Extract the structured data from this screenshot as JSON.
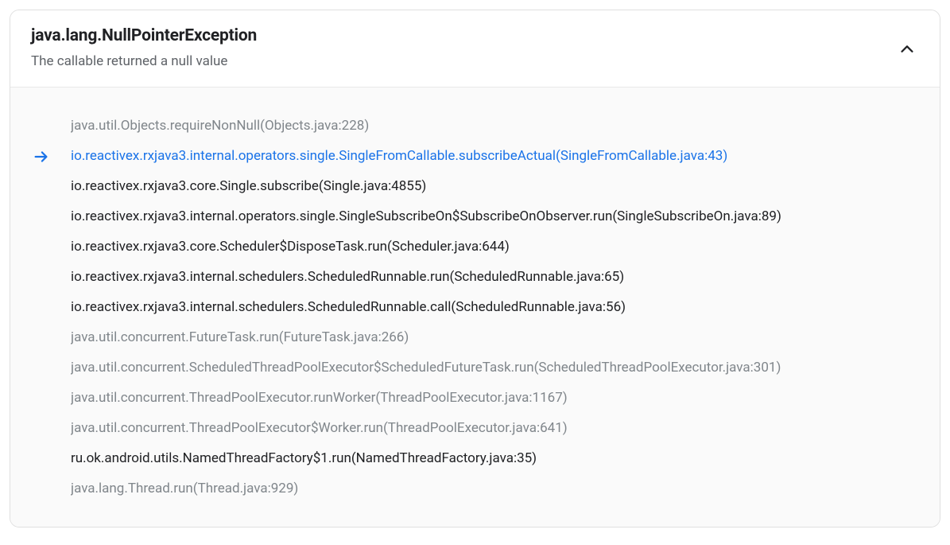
{
  "exception": {
    "title": "java.lang.NullPointerException",
    "message": "The callable returned a null value"
  },
  "stack_frames": [
    {
      "text": "java.util.Objects.requireNonNull(Objects.java:228)",
      "style": "system",
      "highlighted": false
    },
    {
      "text": "io.reactivex.rxjava3.internal.operators.single.SingleFromCallable.subscribeActual(SingleFromCallable.java:43)",
      "style": "app",
      "highlighted": true
    },
    {
      "text": "io.reactivex.rxjava3.core.Single.subscribe(Single.java:4855)",
      "style": "app",
      "highlighted": false
    },
    {
      "text": "io.reactivex.rxjava3.internal.operators.single.SingleSubscribeOn$SubscribeOnObserver.run(SingleSubscribeOn.java:89)",
      "style": "app",
      "highlighted": false
    },
    {
      "text": "io.reactivex.rxjava3.core.Scheduler$DisposeTask.run(Scheduler.java:644)",
      "style": "app",
      "highlighted": false
    },
    {
      "text": "io.reactivex.rxjava3.internal.schedulers.ScheduledRunnable.run(ScheduledRunnable.java:65)",
      "style": "app",
      "highlighted": false
    },
    {
      "text": "io.reactivex.rxjava3.internal.schedulers.ScheduledRunnable.call(ScheduledRunnable.java:56)",
      "style": "app",
      "highlighted": false
    },
    {
      "text": "java.util.concurrent.FutureTask.run(FutureTask.java:266)",
      "style": "system",
      "highlighted": false
    },
    {
      "text": "java.util.concurrent.ScheduledThreadPoolExecutor$ScheduledFutureTask.run(ScheduledThreadPoolExecutor.java:301)",
      "style": "system",
      "highlighted": false
    },
    {
      "text": "java.util.concurrent.ThreadPoolExecutor.runWorker(ThreadPoolExecutor.java:1167)",
      "style": "system",
      "highlighted": false
    },
    {
      "text": "java.util.concurrent.ThreadPoolExecutor$Worker.run(ThreadPoolExecutor.java:641)",
      "style": "system",
      "highlighted": false
    },
    {
      "text": "ru.ok.android.utils.NamedThreadFactory$1.run(NamedThreadFactory.java:35)",
      "style": "app",
      "highlighted": false
    },
    {
      "text": "java.lang.Thread.run(Thread.java:929)",
      "style": "system",
      "highlighted": false
    }
  ],
  "colors": {
    "link": "#1a73e8",
    "text_primary": "#202124",
    "text_secondary": "#5f6368",
    "text_muted": "#80868b"
  }
}
